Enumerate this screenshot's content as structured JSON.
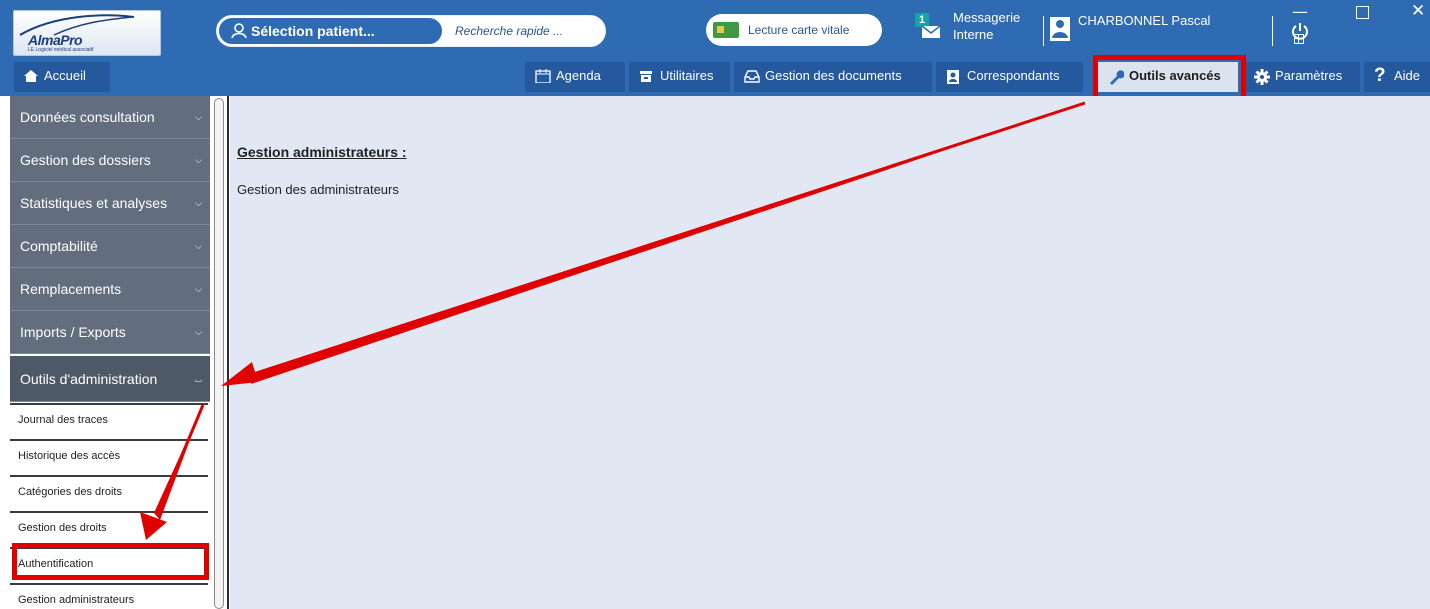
{
  "app": {
    "logo_brand": "AlmaPro",
    "logo_tagline": "LE Logiciel médical associatif"
  },
  "header": {
    "patient_button": "Sélection patient...",
    "quick_search_placeholder": "Recherche rapide ...",
    "vitale_button": "Lecture carte vitale",
    "messages_badge": "1",
    "messages_label": "Messagerie Interne",
    "user_name": "CHARBONNEL Pascal"
  },
  "nav": {
    "home": "Accueil",
    "items": [
      {
        "label": "Agenda",
        "icon": "calendar-icon"
      },
      {
        "label": "Utilitaires",
        "icon": "toolbox-icon"
      },
      {
        "label": "Gestion des documents",
        "icon": "inbox-icon"
      },
      {
        "label": "Correspondants",
        "icon": "contact-card-icon"
      },
      {
        "label": "Outils avancés",
        "icon": "wrench-icon"
      },
      {
        "label": "Paramètres",
        "icon": "gear-icon"
      },
      {
        "label": "Aide",
        "icon": "question-icon"
      }
    ],
    "active": "Outils avancés"
  },
  "sidebar": {
    "sections": [
      "Données consultation",
      "Gestion des dossiers",
      "Statistiques et analyses",
      "Comptabilité",
      "Remplacements",
      "Imports / Exports",
      "Outils d'administration"
    ],
    "open_section": "Outils d'administration",
    "sub_items": [
      "Journal des traces",
      "Historique des accès",
      "Catégories des droits",
      "Gestion des droits",
      "Authentification",
      "Gestion administrateurs"
    ],
    "highlighted_sub_item": "Authentification"
  },
  "main": {
    "title": "Gestion administrateurs :",
    "text": "Gestion des administrateurs"
  },
  "colors": {
    "header_bg": "#2f6bb3",
    "sidebar_section_bg": "#626d7e",
    "content_bg": "#e1e8f3",
    "annotation_red": "#e00000"
  }
}
